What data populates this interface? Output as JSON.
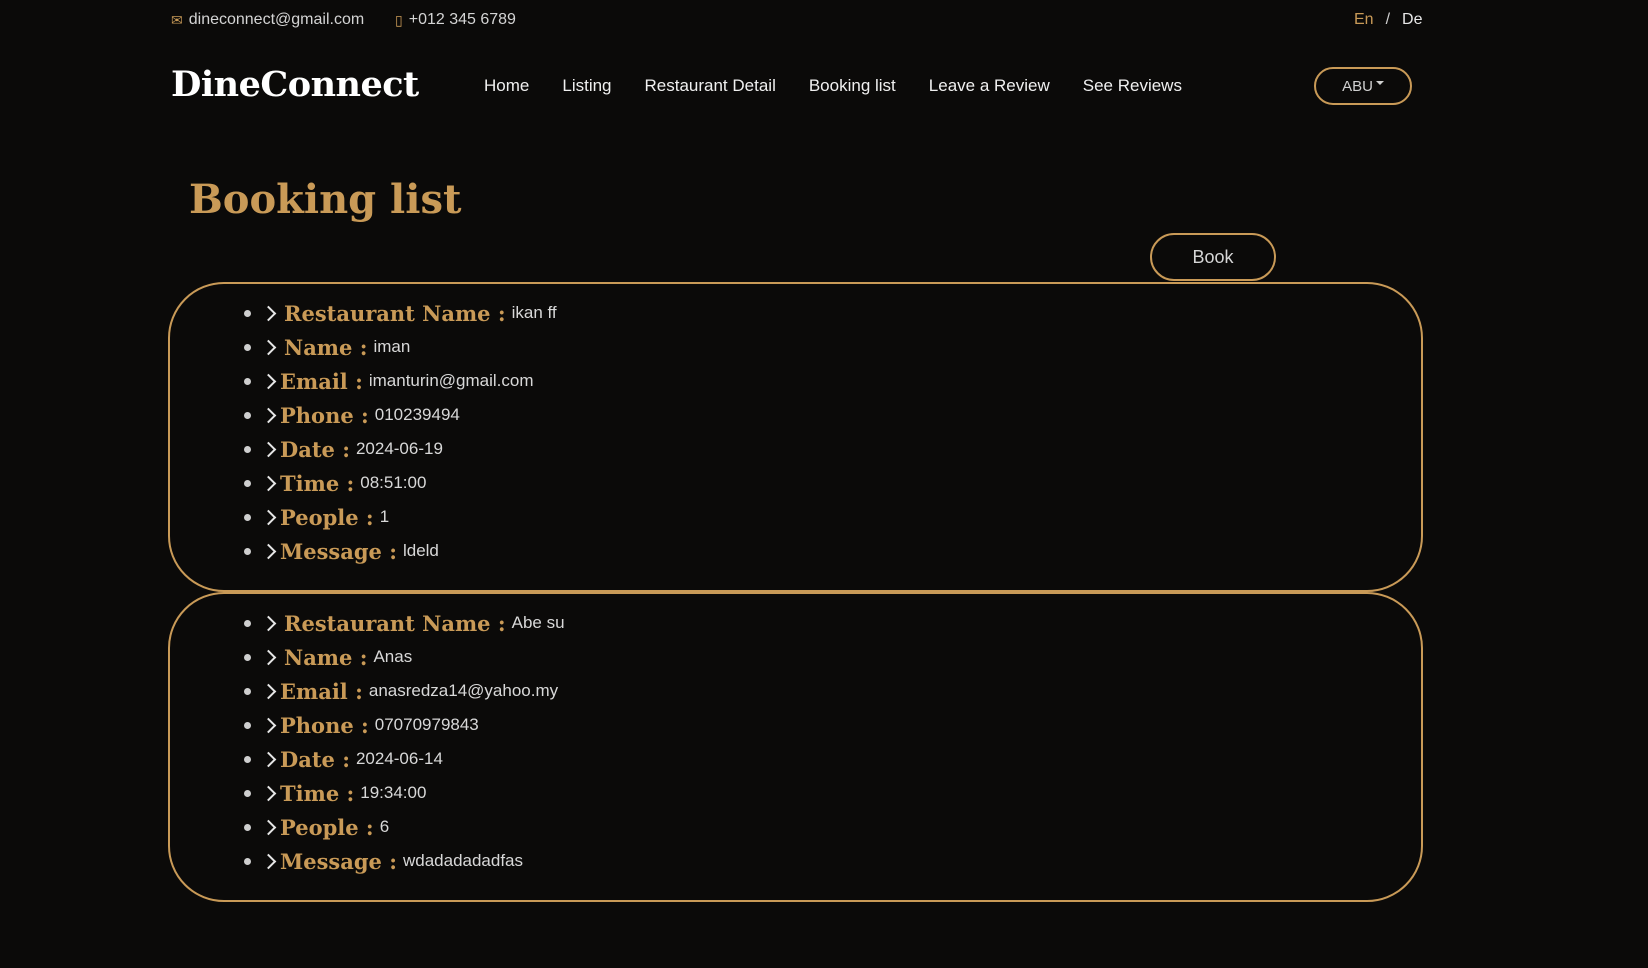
{
  "topbar": {
    "email": "dineconnect@gmail.com",
    "phone": "+012 345 6789",
    "lang_en": "En",
    "lang_sep": "/",
    "lang_de": "De"
  },
  "brand": "DineConnect",
  "nav": {
    "home": "Home",
    "listing": "Listing",
    "restaurant_detail": "Restaurant Detail",
    "booking_list": "Booking list",
    "leave_review": "Leave a Review",
    "see_reviews": "See Reviews"
  },
  "user_menu": "ABU",
  "page_title": "Booking list",
  "book_button": "Book",
  "labels": {
    "restaurant": "Restaurant Name :",
    "name": "Name :",
    "email": "Email :",
    "phone": "Phone :",
    "date": "Date :",
    "time": "Time :",
    "people": "People :",
    "message": "Message :"
  },
  "bookings": [
    {
      "restaurant": "ikan ff",
      "name": "iman",
      "email": "imanturin@gmail.com",
      "phone": "010239494",
      "date": "2024-06-19",
      "time": "08:51:00",
      "people": "1",
      "message": "ldeld"
    },
    {
      "restaurant": "Abe su",
      "name": "Anas",
      "email": "anasredza14@yahoo.my",
      "phone": "07070979843",
      "date": "2024-06-14",
      "time": "19:34:00",
      "people": "6",
      "message": "wdadadadadfas"
    }
  ],
  "colors": {
    "background": "#0b0a09",
    "accent": "#c99a57",
    "text": "#d8d8d8"
  }
}
